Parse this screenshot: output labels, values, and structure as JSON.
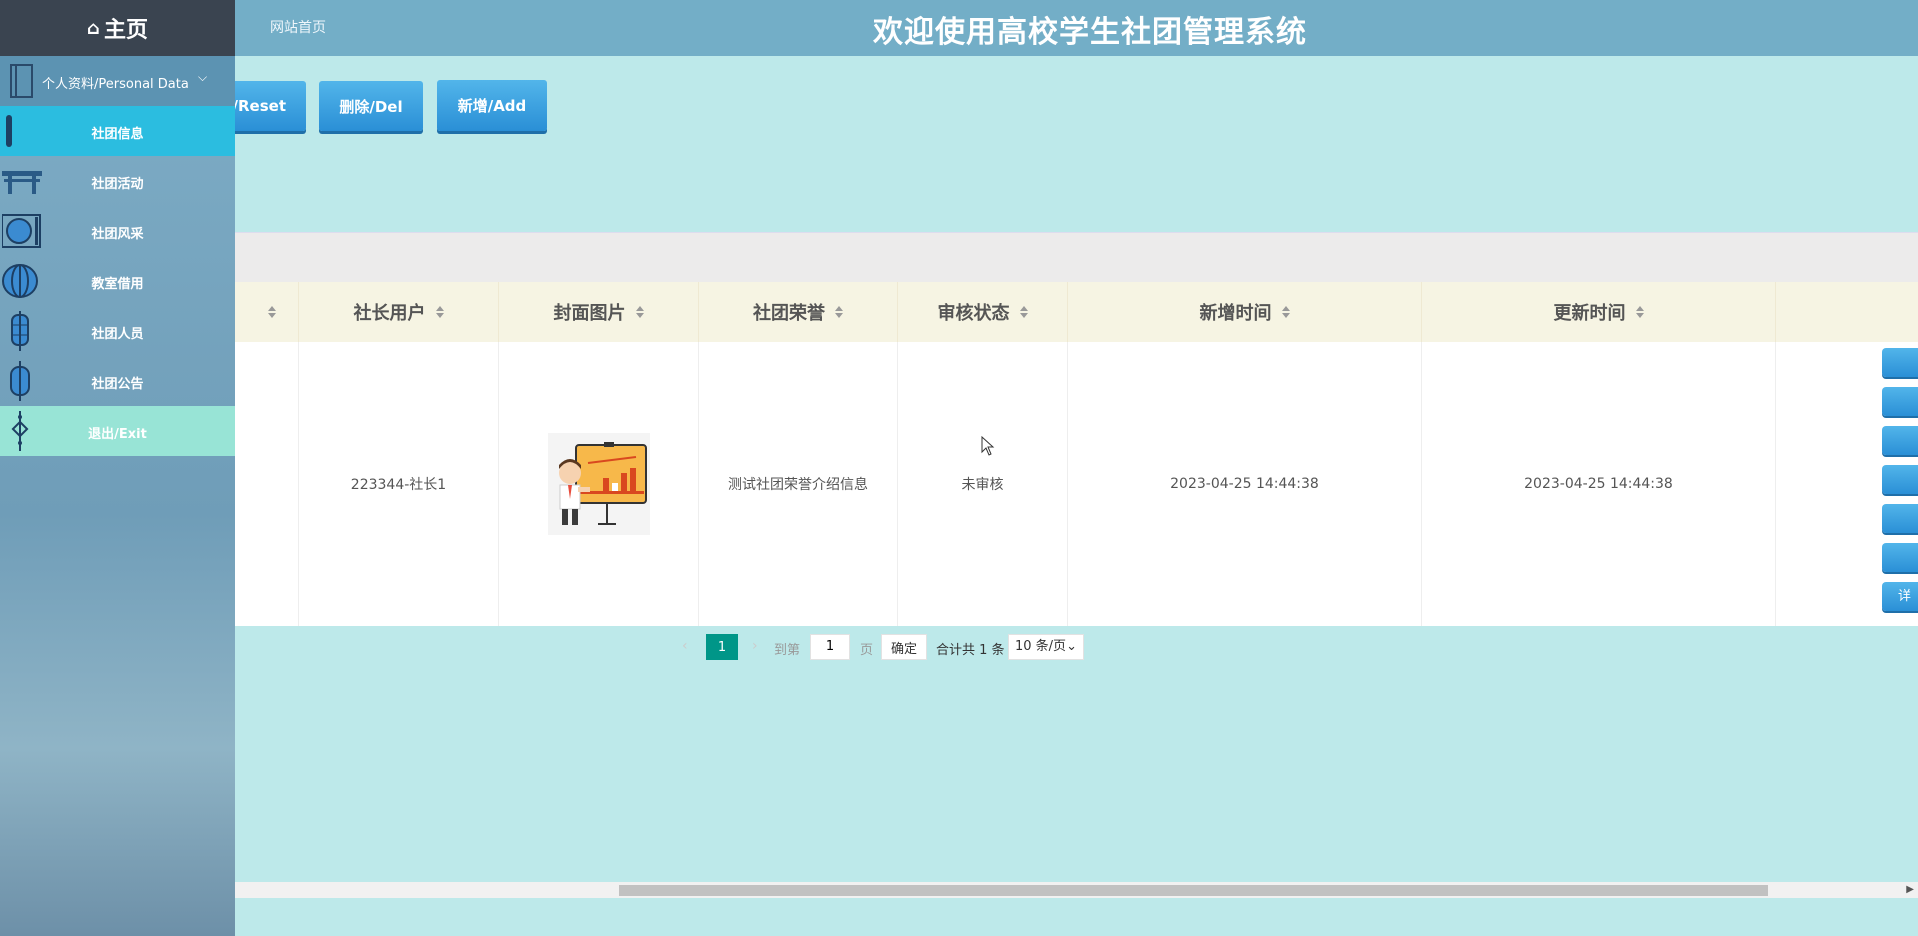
{
  "header": {
    "site_home": "网站首页",
    "system_title": "欢迎使用高校学生社团管理系统"
  },
  "sidebar": {
    "home_label": "主页",
    "group_label": "个人资料/Personal Data",
    "items": [
      {
        "label": "社团信息",
        "active": true
      },
      {
        "label": "社团活动"
      },
      {
        "label": "社团风采"
      },
      {
        "label": "教室借用"
      },
      {
        "label": "社团人员"
      },
      {
        "label": "社团公告"
      },
      {
        "label": "退出/Exit"
      }
    ]
  },
  "toolbar": {
    "reset_label": "i/Reset",
    "delete_label": "删除/Del",
    "add_label": "新增/Add"
  },
  "table": {
    "columns": [
      "社长用户",
      "封面图片",
      "社团荣誉",
      "审核状态",
      "新增时间",
      "更新时间"
    ],
    "rows": [
      {
        "leader_user": "223344-社长1",
        "cover_image": "presentation-chart-illustration",
        "honor": "测试社团荣誉介绍信息",
        "audit_status": "未审核",
        "created_at": "2023-04-25 14:44:38",
        "updated_at": "2023-04-25 14:44:38",
        "action_last_label": "详"
      }
    ]
  },
  "pagination": {
    "current_page": "1",
    "goto_label": "到第",
    "goto_value": "1",
    "page_unit": "页",
    "confirm_label": "确定",
    "total_label": "合计共 1 条",
    "page_size": "10 条/页"
  },
  "colors": {
    "header_bg": "#73aec7",
    "content_bg": "#bde9ea",
    "active_menu": "#2bbde0",
    "button_blue": "#2a8fd6",
    "pager_active": "#009688"
  }
}
